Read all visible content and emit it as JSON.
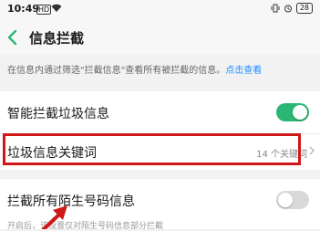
{
  "status_bar": {
    "time": "10:49",
    "hd_label": "HD",
    "battery": "28"
  },
  "header": {
    "title": "信息拦截"
  },
  "notice": {
    "text": "在信息内通过筛选\"拦截信息\"查看所有被拦截的信息。",
    "link": "点击查看"
  },
  "settings": {
    "smart_block": {
      "label": "智能拦截垃圾信息",
      "enabled": true
    },
    "spam_keywords": {
      "label": "垃圾信息关键词",
      "value": "14 个关键词"
    },
    "block_unknown": {
      "label": "拦截所有陌生号码信息",
      "enabled": false,
      "description": "开启后，该设置仅对陌生号码信息部分拦截"
    }
  },
  "colors": {
    "toggle_on": "#2bb673",
    "highlight": "#d01818",
    "link": "#1e8fff"
  }
}
